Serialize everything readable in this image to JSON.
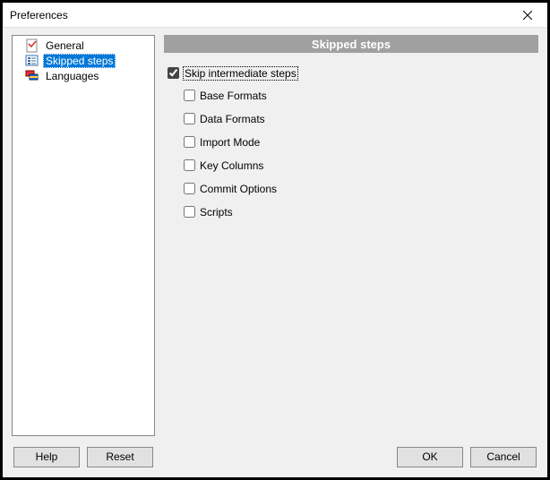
{
  "window": {
    "title": "Preferences"
  },
  "sidebar": {
    "items": [
      {
        "label": "General"
      },
      {
        "label": "Skipped steps"
      },
      {
        "label": "Languages"
      }
    ]
  },
  "main": {
    "banner": "Skipped steps",
    "master_checkbox": {
      "label": "Skip intermediate steps",
      "checked": true
    },
    "sub": [
      {
        "label": "Base Formats",
        "checked": false
      },
      {
        "label": "Data Formats",
        "checked": false
      },
      {
        "label": "Import Mode",
        "checked": false
      },
      {
        "label": "Key Columns",
        "checked": false
      },
      {
        "label": "Commit Options",
        "checked": false
      },
      {
        "label": "Scripts",
        "checked": false
      }
    ]
  },
  "footer": {
    "help": "Help",
    "reset": "Reset",
    "ok": "OK",
    "cancel": "Cancel"
  }
}
